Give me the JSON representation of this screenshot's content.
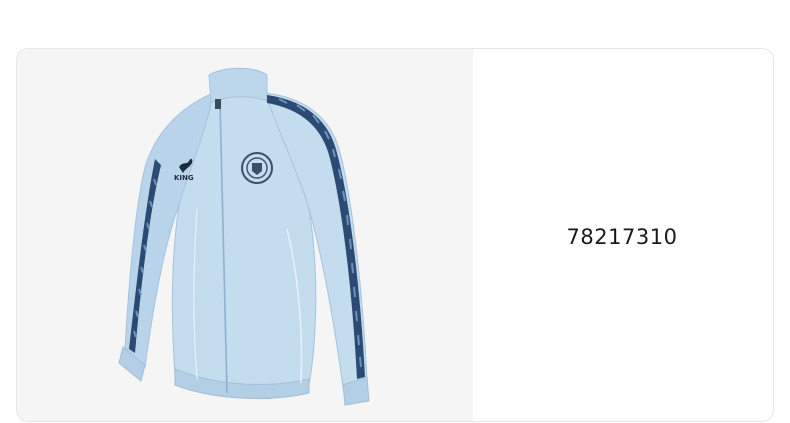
{
  "product": {
    "code": "78217310",
    "image": {
      "name": "light-blue-track-jacket",
      "brand_mark": "KING",
      "colors": {
        "jacket": "#c3dcee",
        "jacket_shade": "#a9c9e2",
        "tape": "#2c4a73",
        "tape_pattern": "#6d93bd",
        "badge": "#3b4f6b",
        "panel_bg": "#f5f5f5"
      }
    }
  }
}
